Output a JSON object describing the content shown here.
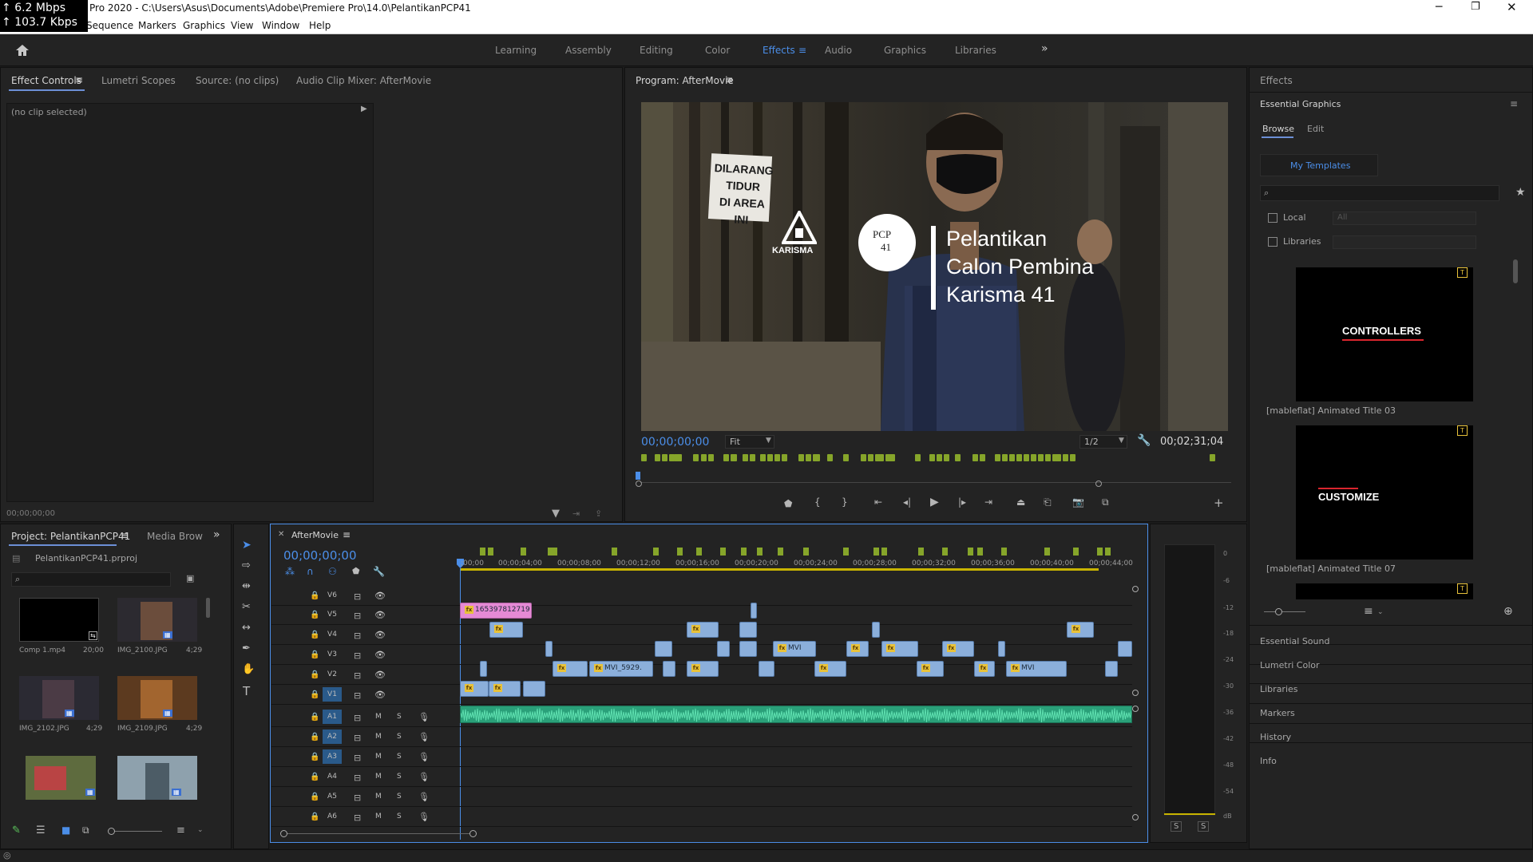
{
  "net": {
    "up": "6.2 Mbps",
    "down": "103.7 Kbps"
  },
  "window": {
    "title": "Pro 2020 - C:\\Users\\Asus\\Documents\\Adobe\\Premiere Pro\\14.0\\PelantikanPCP41"
  },
  "menu": [
    "Sequence",
    "Markers",
    "Graphics",
    "View",
    "Window",
    "Help"
  ],
  "workspaces": [
    "Learning",
    "Assembly",
    "Editing",
    "Color",
    "Effects",
    "Audio",
    "Graphics",
    "Libraries"
  ],
  "active_workspace": "Effects",
  "left_panel": {
    "tabs": [
      "Effect Controls",
      "Lumetri Scopes",
      "Source: (no clips)",
      "Audio Clip Mixer: AfterMovie"
    ],
    "no_clip": "(no clip selected)",
    "timecode": "00;00;00;00"
  },
  "program": {
    "tab": "Program: AfterMovie",
    "timecode": "00;00;00;00",
    "zoom": "Fit",
    "resolution": "1/2",
    "duration": "00;02;31;04",
    "sign": [
      "DILARANG",
      "TIDUR",
      "DI AREA INI"
    ],
    "logo": "KARISMA",
    "badge_top": "PCP",
    "badge_num": "41",
    "title_lines": [
      "Pelantikan",
      "Calon Pembina",
      "Karisma 41"
    ]
  },
  "effects": {
    "header": "Effects",
    "panel_title": "Essential Graphics",
    "tabs": [
      "Browse",
      "Edit"
    ],
    "my_templates": "My Templates",
    "local": "Local",
    "libraries": "Libraries",
    "all": "All",
    "templates": [
      {
        "thumb_text": "CONTROLLERS",
        "name": "[mableflat] Animated Title 03"
      },
      {
        "thumb_text": "CUSTOMIZE",
        "name": "[mableflat] Animated Title 07"
      }
    ],
    "sections": [
      "Essential Sound",
      "Lumetri Color",
      "Libraries",
      "Markers",
      "History",
      "Info"
    ]
  },
  "project": {
    "tabs": [
      "Project: PelantikanPCP41",
      "Media Brow"
    ],
    "file": "PelantikanPCP41.prproj",
    "items": [
      {
        "name": "Comp 1.mp4",
        "dur": "20;00"
      },
      {
        "name": "IMG_2100.JPG",
        "dur": "4;29"
      },
      {
        "name": "IMG_2102.JPG",
        "dur": "4;29"
      },
      {
        "name": "IMG_2109.JPG",
        "dur": "4;29"
      }
    ]
  },
  "timeline": {
    "tab": "AfterMovie",
    "timecode": "00;00;00;00",
    "ruler": [
      ";00;00",
      "00;00;04;00",
      "00;00;08;00",
      "00;00;12;00",
      "00;00;16;00",
      "00;00;20;00",
      "00;00;24;00",
      "00;00;28;00",
      "00;00;32;00",
      "00;00;36;00",
      "00;00;40;00",
      "00;00;44;00"
    ],
    "video_tracks": [
      "V6",
      "V5",
      "V4",
      "V3",
      "V2",
      "V1"
    ],
    "audio_tracks": [
      "A1",
      "A2",
      "A3",
      "A4",
      "A5",
      "A6"
    ],
    "clip_pink": "165397812719",
    "clip_mvi1": "MVI_5929.",
    "clip_mvi2": "MVI",
    "clip_mvi3": "MVI"
  },
  "meter": {
    "scale": [
      "0",
      "-6",
      "-12",
      "-18",
      "-24",
      "-30",
      "-36",
      "-42",
      "-48",
      "-54",
      "dB"
    ],
    "solo": [
      "S",
      "S"
    ]
  },
  "colors": {
    "accent": "#6c8fd6",
    "clip": "#8bafdb",
    "audio": "#2aa079",
    "marker": "#86a52a",
    "pink_clip": "#e58ad5"
  }
}
